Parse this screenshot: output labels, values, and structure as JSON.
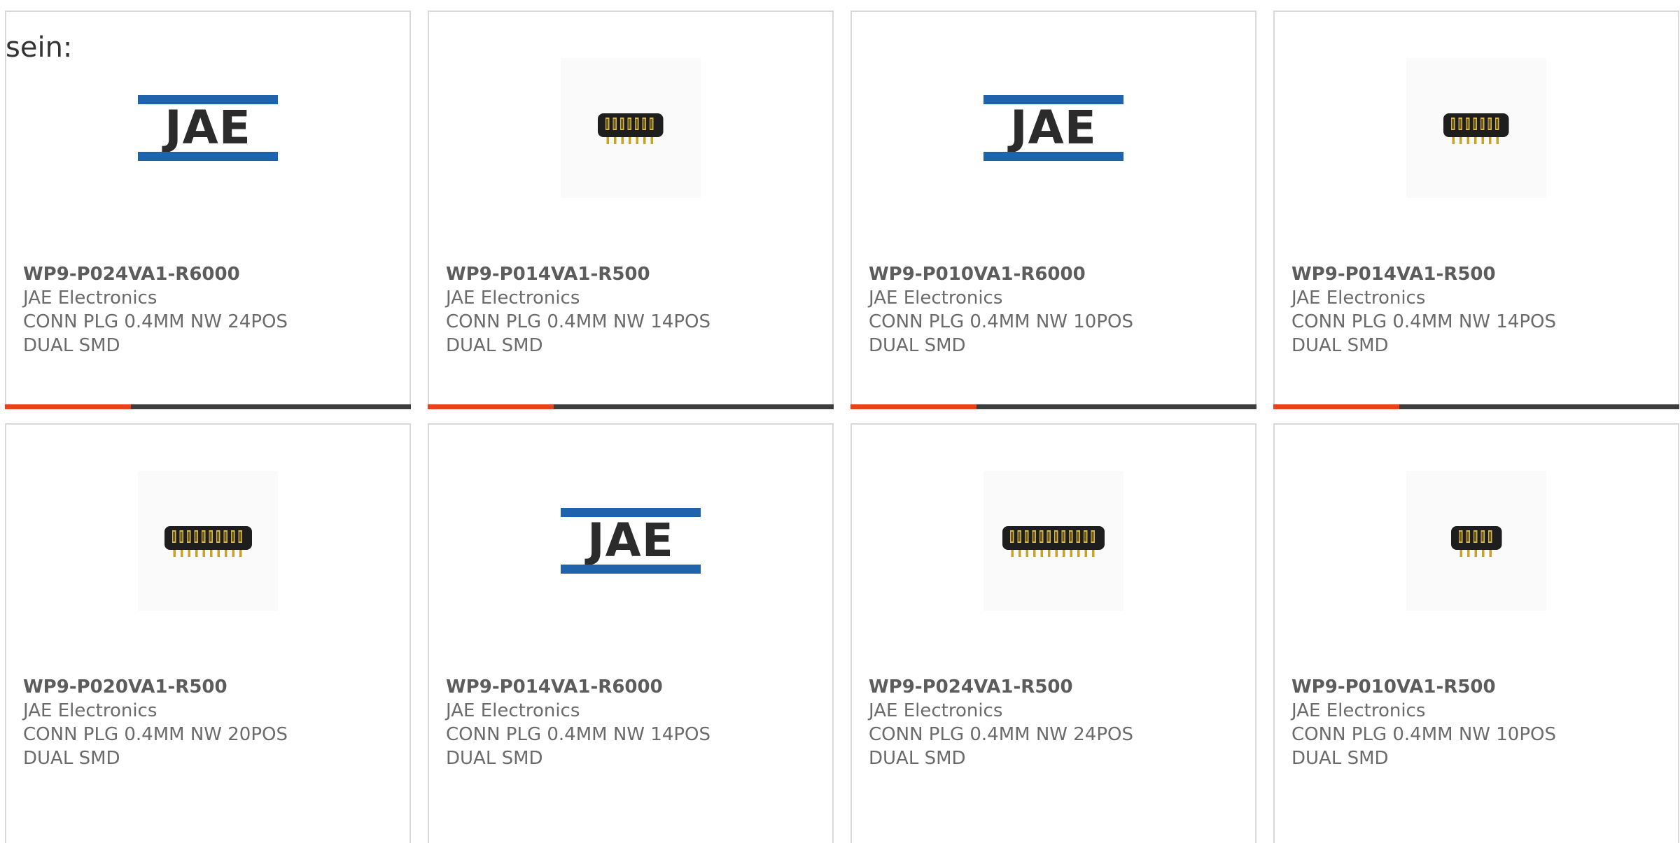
{
  "heading": "sein:",
  "colors": {
    "logo_blue": "#1f63ad",
    "logo_text": "#2b2b2b",
    "progress_accent": "#e8421d",
    "progress_track": "#3d3d3d"
  },
  "products": [
    {
      "part_number": "WP9-P024VA1-R6000",
      "manufacturer": "JAE Electronics",
      "description": "CONN PLG 0.4MM NW 24POS DUAL SMD",
      "image": "jae-logo",
      "logo_text": "JAE",
      "progress": 0.31
    },
    {
      "part_number": "WP9-P014VA1-R500",
      "manufacturer": "JAE Electronics",
      "description": "CONN PLG 0.4MM NW 14POS DUAL SMD",
      "image": "connector-photo",
      "pins": 7,
      "progress": 0.31
    },
    {
      "part_number": "WP9-P010VA1-R6000",
      "manufacturer": "JAE Electronics",
      "description": "CONN PLG 0.4MM NW 10POS DUAL SMD",
      "image": "jae-logo",
      "logo_text": "JAE",
      "progress": 0.31
    },
    {
      "part_number": "WP9-P014VA1-R500",
      "manufacturer": "JAE Electronics",
      "description": "CONN PLG 0.4MM NW 14POS DUAL SMD",
      "image": "connector-photo",
      "pins": 7,
      "progress": 0.31
    },
    {
      "part_number": "WP9-P020VA1-R500",
      "manufacturer": "JAE Electronics",
      "description": "CONN PLG 0.4MM NW 20POS DUAL SMD",
      "image": "connector-photo",
      "pins": 10
    },
    {
      "part_number": "WP9-P014VA1-R6000",
      "manufacturer": "JAE Electronics",
      "description": "CONN PLG 0.4MM NW 14POS DUAL SMD",
      "image": "jae-logo",
      "logo_text": "JAE"
    },
    {
      "part_number": "WP9-P024VA1-R500",
      "manufacturer": "JAE Electronics",
      "description": "CONN PLG 0.4MM NW 24POS DUAL SMD",
      "image": "connector-photo",
      "pins": 12
    },
    {
      "part_number": "WP9-P010VA1-R500",
      "manufacturer": "JAE Electronics",
      "description": "CONN PLG 0.4MM NW 10POS DUAL SMD",
      "image": "connector-photo",
      "pins": 5
    }
  ]
}
